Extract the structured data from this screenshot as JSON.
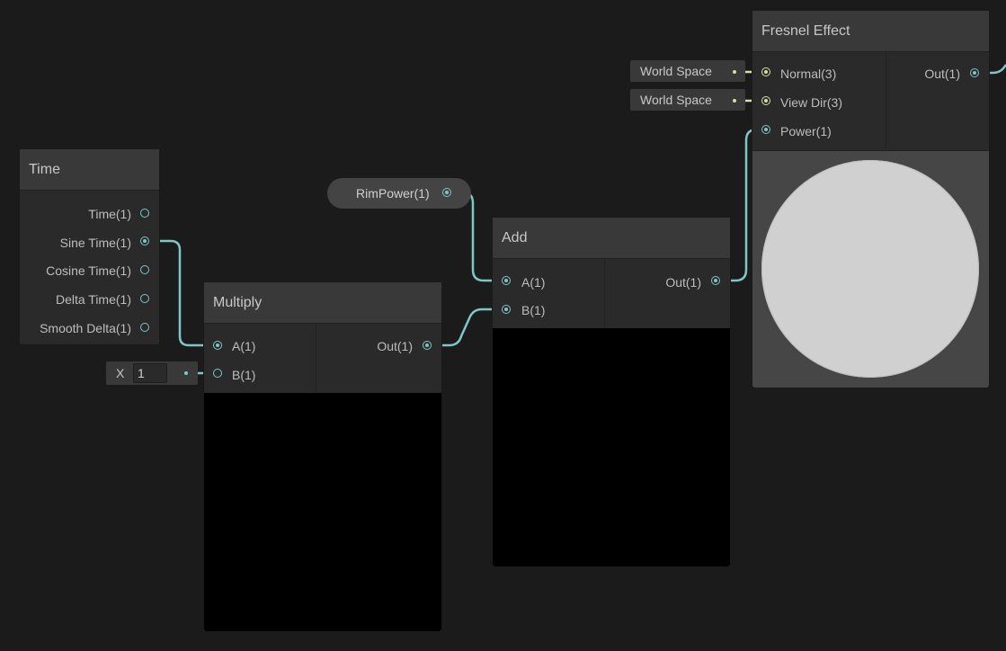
{
  "nodes": {
    "time": {
      "title": "Time",
      "outputs": [
        "Time(1)",
        "Sine Time(1)",
        "Cosine Time(1)",
        "Delta Time(1)",
        "Smooth Delta(1)"
      ]
    },
    "multiply": {
      "title": "Multiply",
      "inputs": [
        "A(1)",
        "B(1)"
      ],
      "output": "Out(1)",
      "b_inline": {
        "axis": "X",
        "value": "1"
      }
    },
    "add": {
      "title": "Add",
      "inputs": [
        "A(1)",
        "B(1)"
      ],
      "output": "Out(1)"
    },
    "fresnel": {
      "title": "Fresnel Effect",
      "inputs": [
        "Normal(3)",
        "View Dir(3)",
        "Power(1)"
      ],
      "output": "Out(1)",
      "normal_space": "World Space",
      "viewdir_space": "World Space"
    },
    "property": {
      "label": "RimPower(1)"
    }
  },
  "colors": {
    "canvas": "#1b1b1b",
    "node_body": "#2a2a2a",
    "node_header": "#393939",
    "float_wire": "#7fc6c6",
    "vector3_wire": "#d9df9f",
    "property_dot": "#8fd46a",
    "preview_sphere": "#d0d0d0"
  }
}
